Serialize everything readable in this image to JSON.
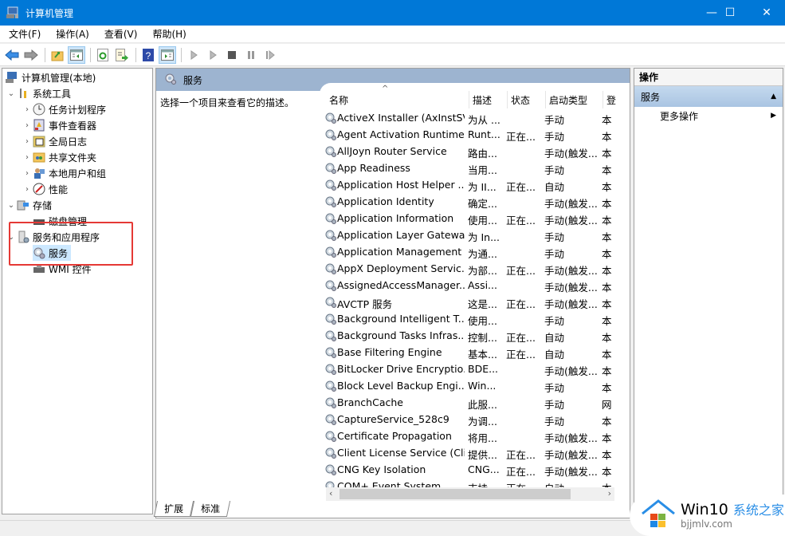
{
  "window": {
    "title": "计算机管理",
    "minimize": "—",
    "maximize": "☐",
    "close": "✕"
  },
  "menu": [
    "文件(F)",
    "操作(A)",
    "查看(V)",
    "帮助(H)"
  ],
  "toolbar": {
    "buttons": [
      "back-icon",
      "forward-icon",
      "up-folder-icon",
      "show-hide-tree-icon",
      "refresh-icon",
      "export-list-icon",
      "help-icon",
      "show-hide-action-pane-icon",
      "start-service-icon",
      "start-service-alt-icon",
      "stop-service-icon",
      "pause-service-icon",
      "restart-service-icon"
    ]
  },
  "tree": {
    "root": "计算机管理(本地)",
    "items": [
      {
        "label": "系统工具",
        "level": 1,
        "expanded": true
      },
      {
        "label": "任务计划程序",
        "level": 2
      },
      {
        "label": "事件查看器",
        "level": 2
      },
      {
        "label": "全局日志",
        "level": 2
      },
      {
        "label": "共享文件夹",
        "level": 2
      },
      {
        "label": "本地用户和组",
        "level": 2
      },
      {
        "label": "性能",
        "level": 2
      },
      {
        "label": "存储",
        "level": 1,
        "expanded": true
      },
      {
        "label": "磁盘管理",
        "level": 2
      },
      {
        "label": "服务和应用程序",
        "level": 1,
        "expanded": true
      },
      {
        "label": "服务",
        "level": 2,
        "selected": true
      },
      {
        "label": "WMI 控件",
        "level": 2
      }
    ]
  },
  "main": {
    "header": "服务",
    "description": "选择一个项目来查看它的描述。",
    "columns": [
      "名称",
      "描述",
      "状态",
      "启动类型",
      "登"
    ],
    "sort_indicator": "^",
    "rows": [
      [
        "ActiveX Installer (AxInstSV)",
        "为从 ...",
        "",
        "手动",
        "本"
      ],
      [
        "Agent Activation Runtime...",
        "Runt...",
        "正在...",
        "手动",
        "本"
      ],
      [
        "AllJoyn Router Service",
        "路由...",
        "",
        "手动(触发...",
        "本"
      ],
      [
        "App Readiness",
        "当用...",
        "",
        "手动",
        "本"
      ],
      [
        "Application Host Helper ...",
        "为 II...",
        "正在...",
        "自动",
        "本"
      ],
      [
        "Application Identity",
        "确定...",
        "",
        "手动(触发...",
        "本"
      ],
      [
        "Application Information",
        "使用...",
        "正在...",
        "手动(触发...",
        "本"
      ],
      [
        "Application Layer Gatewa...",
        "为 In...",
        "",
        "手动",
        "本"
      ],
      [
        "Application Management",
        "为通...",
        "",
        "手动",
        "本"
      ],
      [
        "AppX Deployment Servic...",
        "为部...",
        "正在...",
        "手动(触发...",
        "本"
      ],
      [
        "AssignedAccessManager...",
        "Assi...",
        "",
        "手动(触发...",
        "本"
      ],
      [
        "AVCTP 服务",
        "这是...",
        "正在...",
        "手动(触发...",
        "本"
      ],
      [
        "Background Intelligent T...",
        "使用...",
        "",
        "手动",
        "本"
      ],
      [
        "Background Tasks Infras...",
        "控制...",
        "正在...",
        "自动",
        "本"
      ],
      [
        "Base Filtering Engine",
        "基本...",
        "正在...",
        "自动",
        "本"
      ],
      [
        "BitLocker Drive Encryptio...",
        "BDE...",
        "",
        "手动(触发...",
        "本"
      ],
      [
        "Block Level Backup Engi...",
        "Win...",
        "",
        "手动",
        "本"
      ],
      [
        "BranchCache",
        "此服...",
        "",
        "手动",
        "网"
      ],
      [
        "CaptureService_528c9",
        "为调...",
        "",
        "手动",
        "本"
      ],
      [
        "Certificate Propagation",
        "将用...",
        "",
        "手动(触发...",
        "本"
      ],
      [
        "Client License Service (Cli...",
        "提供...",
        "正在...",
        "手动(触发...",
        "本"
      ],
      [
        "CNG Key Isolation",
        "CNG...",
        "正在...",
        "手动(触发...",
        "本"
      ],
      [
        "COM+ Event System",
        "支持...",
        "正在...",
        "自动",
        "本"
      ]
    ],
    "tabs": [
      "扩展",
      "标准"
    ],
    "active_tab": "扩展"
  },
  "actions": {
    "header": "操作",
    "section": "服务",
    "items": [
      "更多操作"
    ]
  },
  "watermark": {
    "brand": "Win10",
    "cn": "系统之家",
    "url": "bjjmlv.com"
  }
}
